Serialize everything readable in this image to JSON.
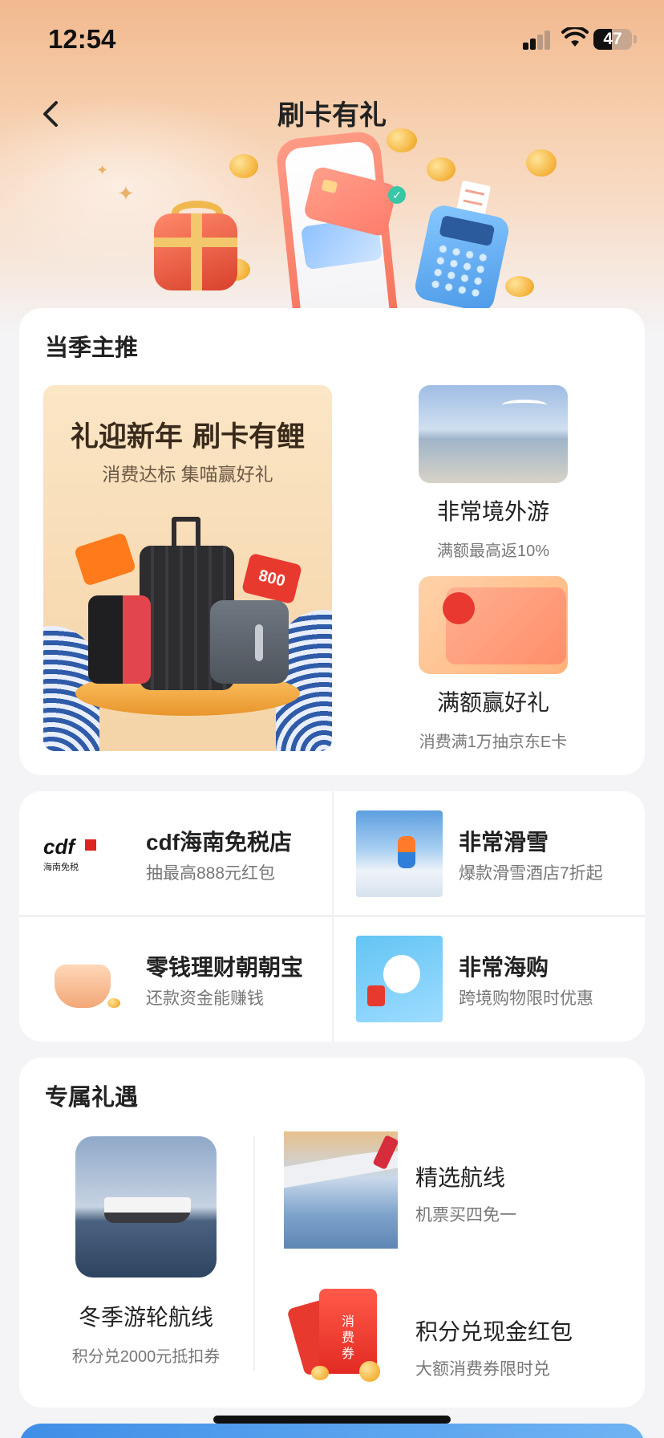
{
  "status_bar": {
    "time": "12:54",
    "battery": "47",
    "battery_level": 0.47
  },
  "header": {
    "title": "刷卡有礼",
    "back_icon": "chevron-left-icon"
  },
  "featured": {
    "section_title": "当季主推",
    "main_promo": {
      "title": "礼迎新年 刷卡有鲤",
      "subtitle": "消费达标 集喵赢好礼",
      "tag_text": "800"
    },
    "items": [
      {
        "name": "非常境外游",
        "desc": "满额最高返10%"
      },
      {
        "name": "满额赢好礼",
        "desc": "消费满1万抽京东E卡"
      }
    ]
  },
  "grid": {
    "items": [
      {
        "name": "cdf海南免税店",
        "desc": "抽最高888元红包",
        "logo_text": "cdf",
        "logo_sub": "海南免税"
      },
      {
        "name": "非常滑雪",
        "desc": "爆款滑雪酒店7折起"
      },
      {
        "name": "零钱理财朝朝宝",
        "desc": "还款资金能赚钱"
      },
      {
        "name": "非常海购",
        "desc": "跨境购物限时优惠"
      }
    ]
  },
  "exclusive": {
    "section_title": "专属礼遇",
    "left": {
      "name": "冬季游轮航线",
      "desc": "积分兑2000元抵扣券"
    },
    "right": [
      {
        "name": "精选航线",
        "desc": "机票买四免一"
      },
      {
        "name": "积分兑现金红包",
        "desc": "大额消费券限时兑",
        "envelope_text": "消费券"
      }
    ]
  }
}
